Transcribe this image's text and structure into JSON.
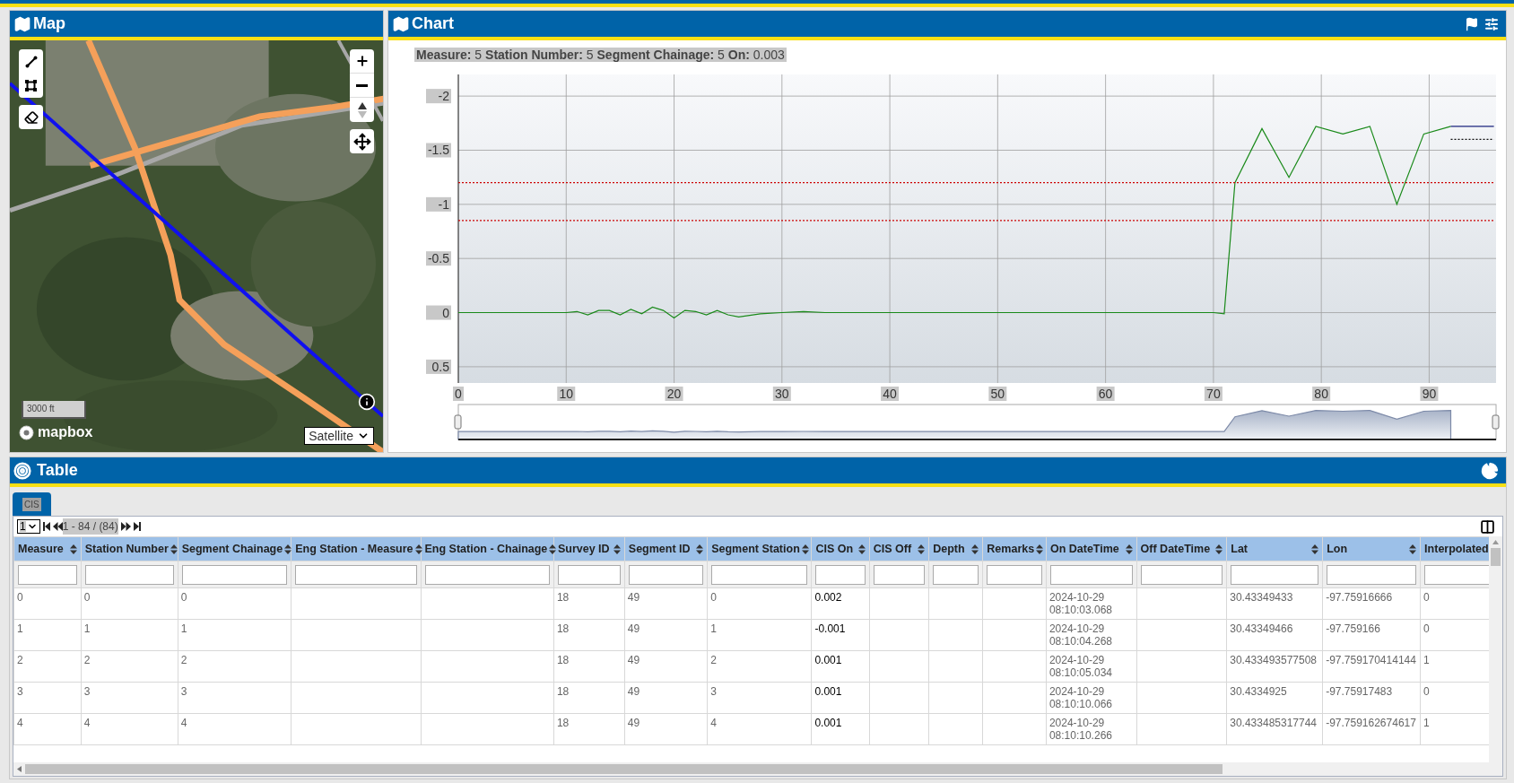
{
  "map_panel": {
    "title": "Map",
    "scale": "3000 ft",
    "attribution": "mapbox",
    "basemap_select": {
      "value": "Satellite"
    }
  },
  "chart_panel": {
    "title": "Chart",
    "readout": "**Measure:** 5 **Station Number:** 5 **Segment Chainage:** 5 **On:** 0.003",
    "chart_data": {
      "type": "line",
      "grid": true,
      "x": [
        0,
        2,
        4,
        6,
        8,
        10,
        11,
        12,
        13,
        14,
        15,
        16,
        17,
        18,
        19,
        20,
        21,
        22,
        23,
        24,
        25,
        26,
        28,
        30,
        32,
        34,
        36,
        38,
        40,
        45,
        50,
        55,
        60,
        65,
        70,
        71,
        72,
        74.5,
        77,
        79.5,
        82,
        84.5,
        87,
        89.5,
        92,
        96
      ],
      "series": [
        {
          "color": "#1a8a1a",
          "line_style": "solid",
          "values": [
            0,
            0,
            0,
            0,
            0,
            0,
            -0.01,
            0.02,
            -0.02,
            -0.02,
            0.02,
            -0.03,
            0.01,
            -0.05,
            -0.02,
            0.05,
            -0.02,
            -0.01,
            0.02,
            -0.02,
            0.02,
            0.04,
            0.01,
            0,
            -0.01,
            0,
            0,
            0,
            0,
            0,
            0,
            0,
            0,
            0,
            0,
            0.01,
            -1.2,
            -1.7,
            -1.25,
            -1.72,
            -1.65,
            -1.72,
            -1.0,
            -1.65,
            -1.72,
            null
          ]
        },
        {
          "color": "#1a237e",
          "line_style": "solid",
          "values": [
            null,
            null,
            null,
            null,
            null,
            null,
            null,
            null,
            null,
            null,
            null,
            null,
            null,
            null,
            null,
            null,
            null,
            null,
            null,
            null,
            null,
            null,
            null,
            null,
            null,
            null,
            null,
            null,
            null,
            null,
            null,
            null,
            null,
            null,
            null,
            null,
            null,
            null,
            null,
            null,
            null,
            null,
            null,
            null,
            -1.72,
            -1.72
          ]
        },
        {
          "color": "#111111",
          "line_style": "dotted",
          "values": [
            null,
            null,
            null,
            null,
            null,
            null,
            null,
            null,
            null,
            null,
            null,
            null,
            null,
            null,
            null,
            null,
            null,
            null,
            null,
            null,
            null,
            null,
            null,
            null,
            null,
            null,
            null,
            null,
            null,
            null,
            null,
            null,
            null,
            null,
            null,
            null,
            null,
            null,
            null,
            null,
            null,
            null,
            null,
            null,
            -1.6,
            -1.6
          ]
        },
        {
          "color": "#cc0000",
          "line_style": "dotted",
          "values": [
            -1.2,
            null,
            null,
            null,
            null,
            null,
            null,
            null,
            null,
            null,
            null,
            null,
            null,
            null,
            null,
            null,
            null,
            null,
            null,
            null,
            null,
            null,
            null,
            null,
            null,
            null,
            null,
            null,
            null,
            null,
            null,
            null,
            null,
            null,
            null,
            null,
            null,
            null,
            null,
            null,
            null,
            null,
            null,
            null,
            null,
            -1.2
          ]
        },
        {
          "color": "#cc0000",
          "line_style": "dotted",
          "values": [
            -0.85,
            null,
            null,
            null,
            null,
            null,
            null,
            null,
            null,
            null,
            null,
            null,
            null,
            null,
            null,
            null,
            null,
            null,
            null,
            null,
            null,
            null,
            null,
            null,
            null,
            null,
            null,
            null,
            null,
            null,
            null,
            null,
            null,
            null,
            null,
            null,
            null,
            null,
            null,
            null,
            null,
            null,
            null,
            null,
            null,
            -0.85
          ]
        }
      ],
      "xlim": [
        0,
        96.2
      ],
      "ylim": [
        0.65,
        -2.2
      ],
      "xticks": [
        0,
        10,
        20,
        30,
        40,
        50,
        60,
        70,
        80,
        90
      ],
      "yticks": [
        -2,
        -1.5,
        -1,
        -0.5,
        0,
        0.5
      ]
    }
  },
  "table_panel": {
    "title": "Table",
    "tabs": [
      {
        "label": "CIS",
        "selected": true
      }
    ],
    "pager": {
      "page_select": "1",
      "range": "1 - 84 / (84)"
    },
    "columns": [
      {
        "label": "Measure",
        "sortable": true
      },
      {
        "label": "Station Number",
        "sortable": true
      },
      {
        "label": "Segment Chainage",
        "sortable": true
      },
      {
        "label": "Eng Station - Measure",
        "sortable": true
      },
      {
        "label": "Eng Station - Chainage",
        "sortable": true
      },
      {
        "label": "Survey ID",
        "sortable": true
      },
      {
        "label": "Segment ID",
        "sortable": true
      },
      {
        "label": "Segment Station",
        "sortable": true
      },
      {
        "label": "CIS On",
        "sortable": true
      },
      {
        "label": "CIS Off",
        "sortable": true
      },
      {
        "label": "Depth",
        "sortable": true
      },
      {
        "label": "Remarks",
        "sortable": true
      },
      {
        "label": "On DateTime",
        "sortable": true
      },
      {
        "label": "Off DateTime",
        "sortable": true
      },
      {
        "label": "Lat",
        "sortable": true
      },
      {
        "label": "Lon",
        "sortable": true
      },
      {
        "label": "Interpolated",
        "sortable": false
      }
    ],
    "rows": [
      [
        "0",
        "0",
        "0",
        null,
        null,
        "18",
        "49",
        "0",
        "0.002",
        null,
        null,
        null,
        "2024-10-29 08:10:03.068",
        null,
        "30.43349433",
        "-97.75916666",
        "0"
      ],
      [
        "1",
        "1",
        "1",
        null,
        null,
        "18",
        "49",
        "1",
        "-0.001",
        null,
        null,
        null,
        "2024-10-29 08:10:04.268",
        null,
        "30.43349466",
        "-97.759166",
        "0"
      ],
      [
        "2",
        "2",
        "2",
        null,
        null,
        "18",
        "49",
        "2",
        "0.001",
        null,
        null,
        null,
        "2024-10-29 08:10:05.034",
        null,
        "30.433493577508",
        "-97.759170414144",
        "1"
      ],
      [
        "3",
        "3",
        "3",
        null,
        null,
        "18",
        "49",
        "3",
        "0.001",
        null,
        null,
        null,
        "2024-10-29 08:10:10.066",
        null,
        "30.4334925",
        "-97.75917483",
        "0"
      ],
      [
        "4",
        "4",
        "4",
        null,
        null,
        "18",
        "49",
        "4",
        "0.001",
        null,
        null,
        null,
        "2024-10-29 08:10:10.266",
        null,
        "30.433485317744",
        "-97.759162674617",
        "1"
      ]
    ]
  }
}
